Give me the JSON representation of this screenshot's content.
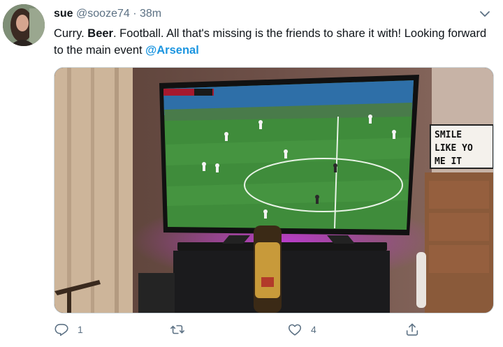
{
  "tweet": {
    "display_name": "sue",
    "handle": "@sooze74",
    "separator": "·",
    "time": "38m",
    "text_part1": "Curry. ",
    "text_bold": "Beer",
    "text_part2": ". Football. All that's missing is the friends to share it with! Looking forward to the main event ",
    "mention": "@Arsenal"
  },
  "media": {
    "description_icons": "photo",
    "sign_lines": [
      "SMILE",
      "LIKE YO",
      "ME  IT"
    ]
  },
  "actions": {
    "reply_count": "1",
    "retweet_count": "",
    "like_count": "4"
  },
  "colors": {
    "accent": "#1b95e0",
    "muted": "#5b7083"
  },
  "icons": [
    "caret-down-icon",
    "reply-icon",
    "retweet-icon",
    "like-icon",
    "share-icon"
  ]
}
